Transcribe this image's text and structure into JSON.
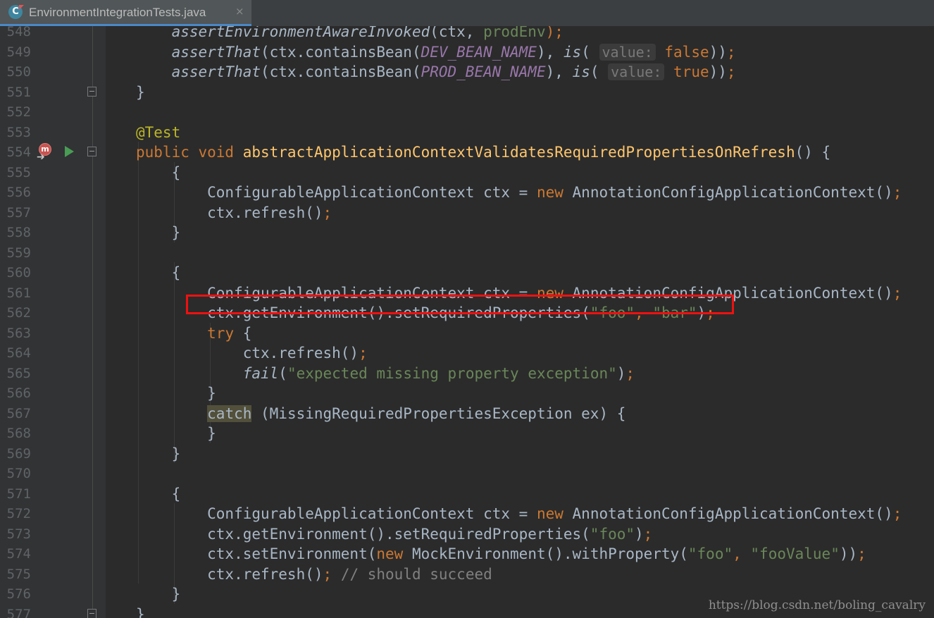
{
  "tab": {
    "title": "EnvironmentIntegrationTests.java",
    "icon": "java-class-icon",
    "close": "×"
  },
  "editor": {
    "lines": [
      {
        "num": "548",
        "gutter": [],
        "tokens": [
          [
            "",
            "    "
          ],
          [
            "it",
            "assertEnvironmentAwareInvoked"
          ],
          [
            "",
            "(ctx, "
          ],
          [
            "s",
            "prodEnv"
          ],
          [
            "kw",
            ");"
          ]
        ]
      },
      {
        "num": "549",
        "gutter": [],
        "tokens": [
          [
            "",
            "    "
          ],
          [
            "it",
            "assertThat"
          ],
          [
            "",
            "(ctx.containsBean("
          ],
          [
            "st",
            "DEV_BEAN_NAME"
          ],
          [
            "",
            "), "
          ],
          [
            "it",
            "is"
          ],
          [
            "",
            "( "
          ],
          [
            "hint",
            "value:"
          ],
          [
            "kw",
            " false"
          ],
          [
            "",
            "))"
          ],
          [
            "kw",
            ";"
          ]
        ]
      },
      {
        "num": "550",
        "gutter": [],
        "tokens": [
          [
            "",
            "    "
          ],
          [
            "it",
            "assertThat"
          ],
          [
            "",
            "(ctx.containsBean("
          ],
          [
            "st",
            "PROD_BEAN_NAME"
          ],
          [
            "",
            "), "
          ],
          [
            "it",
            "is"
          ],
          [
            "",
            "( "
          ],
          [
            "hint",
            "value:"
          ],
          [
            "kw",
            " true"
          ],
          [
            "",
            "))"
          ],
          [
            "kw",
            ";"
          ]
        ]
      },
      {
        "num": "551",
        "gutter": [
          "fold"
        ],
        "tokens": [
          [
            "",
            "}"
          ]
        ]
      },
      {
        "num": "552",
        "gutter": [],
        "tokens": []
      },
      {
        "num": "553",
        "gutter": [],
        "tokens": [
          [
            "ann",
            "@Test"
          ]
        ]
      },
      {
        "num": "554",
        "gutter": [
          "impl",
          "run",
          "fold"
        ],
        "tokens": [
          [
            "kw",
            "public void "
          ],
          [
            "fn",
            "abstractApplicationContextValidatesRequiredPropertiesOnRefresh"
          ],
          [
            "",
            "() {"
          ]
        ]
      },
      {
        "num": "555",
        "gutter": [],
        "tokens": [
          [
            "",
            "    {"
          ]
        ]
      },
      {
        "num": "556",
        "gutter": [],
        "tokens": [
          [
            "",
            "        ConfigurableApplicationContext ctx = "
          ],
          [
            "kw",
            "new "
          ],
          [
            "",
            "AnnotationConfigApplicationContext()"
          ],
          [
            "kw",
            ";"
          ]
        ]
      },
      {
        "num": "557",
        "gutter": [],
        "tokens": [
          [
            "",
            "        ctx.refresh()"
          ],
          [
            "kw",
            ";"
          ]
        ]
      },
      {
        "num": "558",
        "gutter": [],
        "tokens": [
          [
            "",
            "    }"
          ]
        ]
      },
      {
        "num": "559",
        "gutter": [],
        "tokens": []
      },
      {
        "num": "560",
        "gutter": [],
        "tokens": [
          [
            "",
            "    {"
          ]
        ]
      },
      {
        "num": "561",
        "gutter": [],
        "tokens": [
          [
            "",
            "        ConfigurableApplicationContext ctx = "
          ],
          [
            "kw",
            "new "
          ],
          [
            "",
            "AnnotationConfigApplicationContext()"
          ],
          [
            "kw",
            ";"
          ]
        ]
      },
      {
        "num": "562",
        "gutter": [],
        "tokens": [
          [
            "",
            "        ctx.getEnvironment().setRequiredProperties("
          ],
          [
            "s",
            "\"foo\""
          ],
          [
            "kw",
            ", "
          ],
          [
            "s",
            "\"bar\""
          ],
          [
            "",
            ")"
          ],
          [
            "kw",
            ";"
          ]
        ]
      },
      {
        "num": "563",
        "gutter": [],
        "tokens": [
          [
            "",
            "        "
          ],
          [
            "kw",
            "try "
          ],
          [
            "",
            "{"
          ]
        ]
      },
      {
        "num": "564",
        "gutter": [],
        "tokens": [
          [
            "",
            "            ctx.refresh()"
          ],
          [
            "kw",
            ";"
          ]
        ]
      },
      {
        "num": "565",
        "gutter": [],
        "tokens": [
          [
            "",
            "            "
          ],
          [
            "it",
            "fail"
          ],
          [
            "",
            "("
          ],
          [
            "s",
            "\"expected missing property exception\""
          ],
          [
            "",
            ")"
          ],
          [
            "kw",
            ";"
          ]
        ]
      },
      {
        "num": "566",
        "gutter": [],
        "tokens": [
          [
            "",
            "        }"
          ]
        ]
      },
      {
        "num": "567",
        "gutter": [],
        "tokens": [
          [
            "",
            "        "
          ],
          [
            "catch",
            "catch"
          ],
          [
            "",
            " (MissingRequiredPropertiesException ex) {"
          ]
        ]
      },
      {
        "num": "568",
        "gutter": [],
        "tokens": [
          [
            "",
            "        }"
          ]
        ]
      },
      {
        "num": "569",
        "gutter": [],
        "tokens": [
          [
            "",
            "    }"
          ]
        ]
      },
      {
        "num": "570",
        "gutter": [],
        "tokens": []
      },
      {
        "num": "571",
        "gutter": [],
        "tokens": [
          [
            "",
            "    {"
          ]
        ]
      },
      {
        "num": "572",
        "gutter": [],
        "tokens": [
          [
            "",
            "        ConfigurableApplicationContext ctx = "
          ],
          [
            "kw",
            "new "
          ],
          [
            "",
            "AnnotationConfigApplicationContext()"
          ],
          [
            "kw",
            ";"
          ]
        ]
      },
      {
        "num": "573",
        "gutter": [],
        "tokens": [
          [
            "",
            "        ctx.getEnvironment().setRequiredProperties("
          ],
          [
            "s",
            "\"foo\""
          ],
          [
            "",
            ")"
          ],
          [
            "kw",
            ";"
          ]
        ]
      },
      {
        "num": "574",
        "gutter": [],
        "tokens": [
          [
            "",
            "        ctx.setEnvironment("
          ],
          [
            "kw",
            "new "
          ],
          [
            "",
            "MockEnvironment().withProperty("
          ],
          [
            "s",
            "\"foo\""
          ],
          [
            "kw",
            ", "
          ],
          [
            "s",
            "\"fooValue\""
          ],
          [
            "",
            "))"
          ],
          [
            "kw",
            ";"
          ]
        ]
      },
      {
        "num": "575",
        "gutter": [],
        "tokens": [
          [
            "",
            "        ctx.refresh()"
          ],
          [
            "kw",
            "; "
          ],
          [
            "cm",
            "// should succeed"
          ]
        ]
      },
      {
        "num": "576",
        "gutter": [],
        "tokens": [
          [
            "",
            "    }"
          ]
        ]
      },
      {
        "num": "577",
        "gutter": [
          "fold"
        ],
        "tokens": [
          [
            "",
            "}"
          ]
        ]
      }
    ],
    "highlighted_line": "562"
  },
  "watermark": "https://blog.csdn.net/boling_cavalry"
}
